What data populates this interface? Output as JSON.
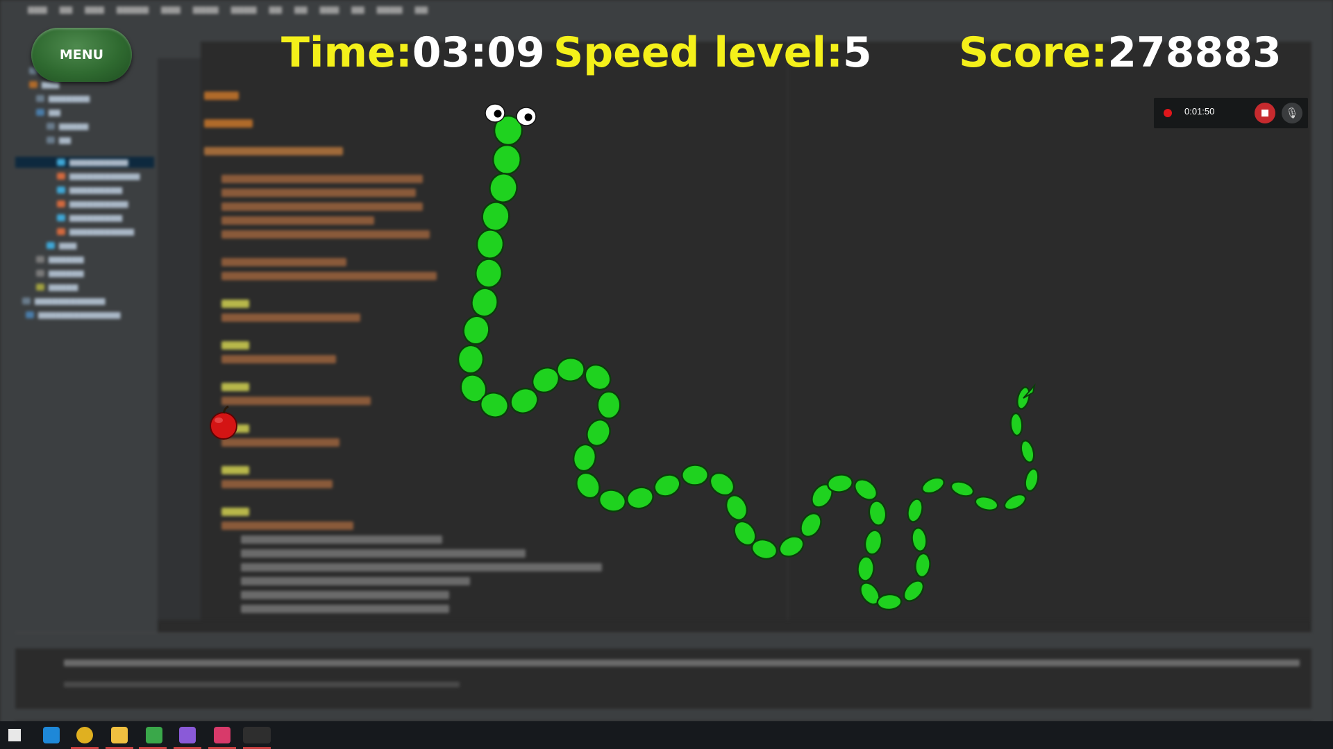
{
  "hud": {
    "menu_label": "MENU",
    "time_label": "Time:",
    "time_value": "03:09",
    "speed_label": "Speed level:",
    "speed_value": "5",
    "score_label": "Score:",
    "score_value": "278883"
  },
  "recording": {
    "elapsed": "0:01:50",
    "icons": [
      "record-dot-icon",
      "stop-icon",
      "mic-muted-icon"
    ]
  },
  "colors": {
    "hud_label": "#f4f01a",
    "hud_value": "#ffffff",
    "snake_body": "#1fd21f",
    "snake_outline": "#0b3d0b",
    "apple": "#d41414",
    "background": "#2b2b2b"
  },
  "game": {
    "snake_segments": 49,
    "apple_count": 1
  }
}
